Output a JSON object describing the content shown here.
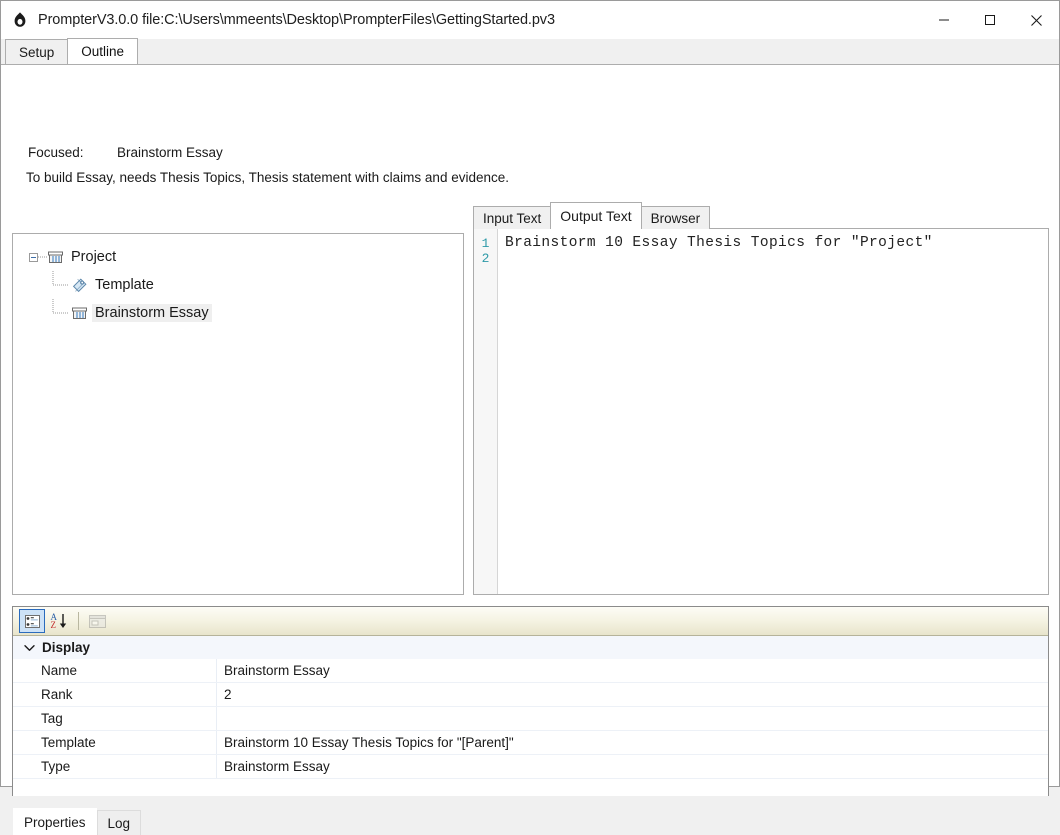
{
  "window": {
    "icon": "flame-icon",
    "title": "PrompterV3.0.0 file:C:\\Users\\mmeents\\Desktop\\PrompterFiles\\GettingStarted.pv3",
    "minimize_label": "—",
    "maximize_label": "□",
    "close_label": "✕"
  },
  "main_tabs": [
    {
      "label": "Setup",
      "selected": false
    },
    {
      "label": "Outline",
      "selected": true
    }
  ],
  "outline": {
    "focused_label": "Focused:",
    "focused_value": "Brainstorm Essay",
    "hint": "To build Essay, needs Thesis Topics, Thesis statement with claims and evidence.",
    "tree": [
      {
        "label": "Project",
        "icon": "box-icon",
        "depth": 0,
        "expanded": true,
        "selected": false
      },
      {
        "label": "Template",
        "icon": "tag-icon",
        "depth": 1,
        "expanded": null,
        "selected": false
      },
      {
        "label": "Brainstorm Essay",
        "icon": "box-icon",
        "depth": 1,
        "expanded": null,
        "selected": true
      }
    ]
  },
  "editor": {
    "tabs": [
      {
        "label": "Input Text",
        "selected": false
      },
      {
        "label": "Output Text",
        "selected": true
      },
      {
        "label": "Browser",
        "selected": false
      }
    ],
    "line_numbers": [
      "1",
      "2"
    ],
    "lines": [
      "Brainstorm 10 Essay Thesis Topics for \"Project\"",
      ""
    ],
    "gutter_color": "#2e9aa8"
  },
  "properties": {
    "toolbar": [
      {
        "name": "categorized-view-button",
        "active": true
      },
      {
        "name": "alphabetical-sort-button",
        "active": false
      },
      {
        "name": "property-pages-button",
        "active": false,
        "disabled": true
      }
    ],
    "category": "Display",
    "rows": [
      {
        "name": "Name",
        "value": "Brainstorm Essay"
      },
      {
        "name": "Rank",
        "value": "2"
      },
      {
        "name": "Tag",
        "value": ""
      },
      {
        "name": "Template",
        "value": "Brainstorm 10 Essay Thesis Topics for \"[Parent]\""
      },
      {
        "name": "Type",
        "value": "Brainstorm Essay"
      }
    ]
  },
  "bottom_tabs": [
    {
      "label": "Properties",
      "selected": true
    },
    {
      "label": "Log",
      "selected": false
    }
  ],
  "colors": {
    "accent": "#2a6bbd",
    "gutter_text": "#2e9aa8",
    "category_bg": "#f4f7fc",
    "toolbar_bg": "#f5f3e3"
  }
}
